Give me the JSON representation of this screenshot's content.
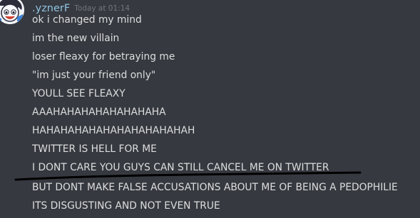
{
  "message": {
    "author": ".yznerF",
    "timestamp": "Today at 01:14",
    "lines": [
      "ok i changed my mind",
      "im the new villain",
      "loser fleaxy for betraying me",
      "\"im just your friend only\"",
      "YOULL SEE FLEAXY",
      "AAAHAHAHAHAHAHAHAHA",
      "HAHAHAHAHAHAHAHAHAHAHAH",
      "TWITTER IS HELL FOR ME",
      "I DONT CARE YOU GUYS CAN STILL CANCEL ME ON TWITTER",
      "BUT DONT MAKE FALSE ACCUSATIONS ABOUT ME OF BEING A PEDOPHILIE",
      "ITS DISGUSTING AND NOT EVEN TRUE"
    ]
  },
  "colors": {
    "background": "#36393f",
    "username": "#8fc4e2",
    "text": "#dcddde",
    "timestamp": "#72767d",
    "annotation_stroke": "#000000"
  },
  "icons": {
    "avatar": "cartoon-character-avatar",
    "annotation": "hand-drawn-underline"
  }
}
